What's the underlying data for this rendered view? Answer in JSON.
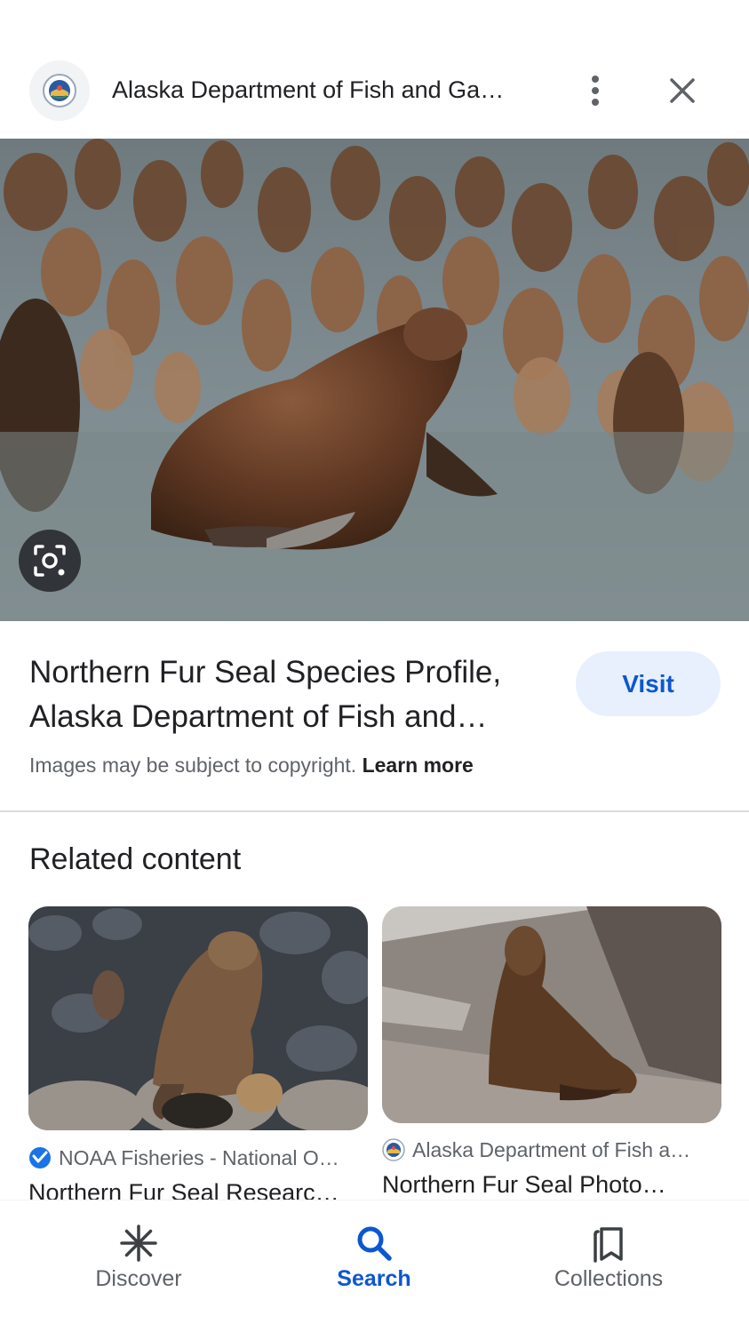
{
  "header": {
    "title": "Alaska Department of Fish and Ga…",
    "logo_icon": "adfg-seal-logo",
    "more_icon": "more-vert-icon",
    "close_icon": "close-icon"
  },
  "main_image": {
    "lens_icon": "lens-search-icon"
  },
  "result": {
    "title": "Northern Fur Seal Species Profile, Alaska Department of Fish and…",
    "visit_label": "Visit",
    "copyright_text": "Images may be subject to copyright.",
    "learn_more_label": "Learn more"
  },
  "related": {
    "heading": "Related content",
    "cards": [
      {
        "source": "NOAA Fisheries - National O…",
        "title": "Northern Fur Seal Researc…",
        "source_icon": "noaa-logo-icon"
      },
      {
        "source": "Alaska Department of Fish a…",
        "title": "Northern Fur Seal Photo…",
        "source_icon": "adfg-seal-logo"
      }
    ]
  },
  "bottom_nav": {
    "items": [
      {
        "label": "Discover",
        "icon": "asterisk-icon",
        "active": false
      },
      {
        "label": "Search",
        "icon": "search-icon",
        "active": true
      },
      {
        "label": "Collections",
        "icon": "collections-icon",
        "active": false
      }
    ]
  },
  "colors": {
    "accent": "#0b57d0",
    "visit_bg": "#e8f0fe",
    "text_primary": "#202124",
    "text_secondary": "#5f6368"
  }
}
